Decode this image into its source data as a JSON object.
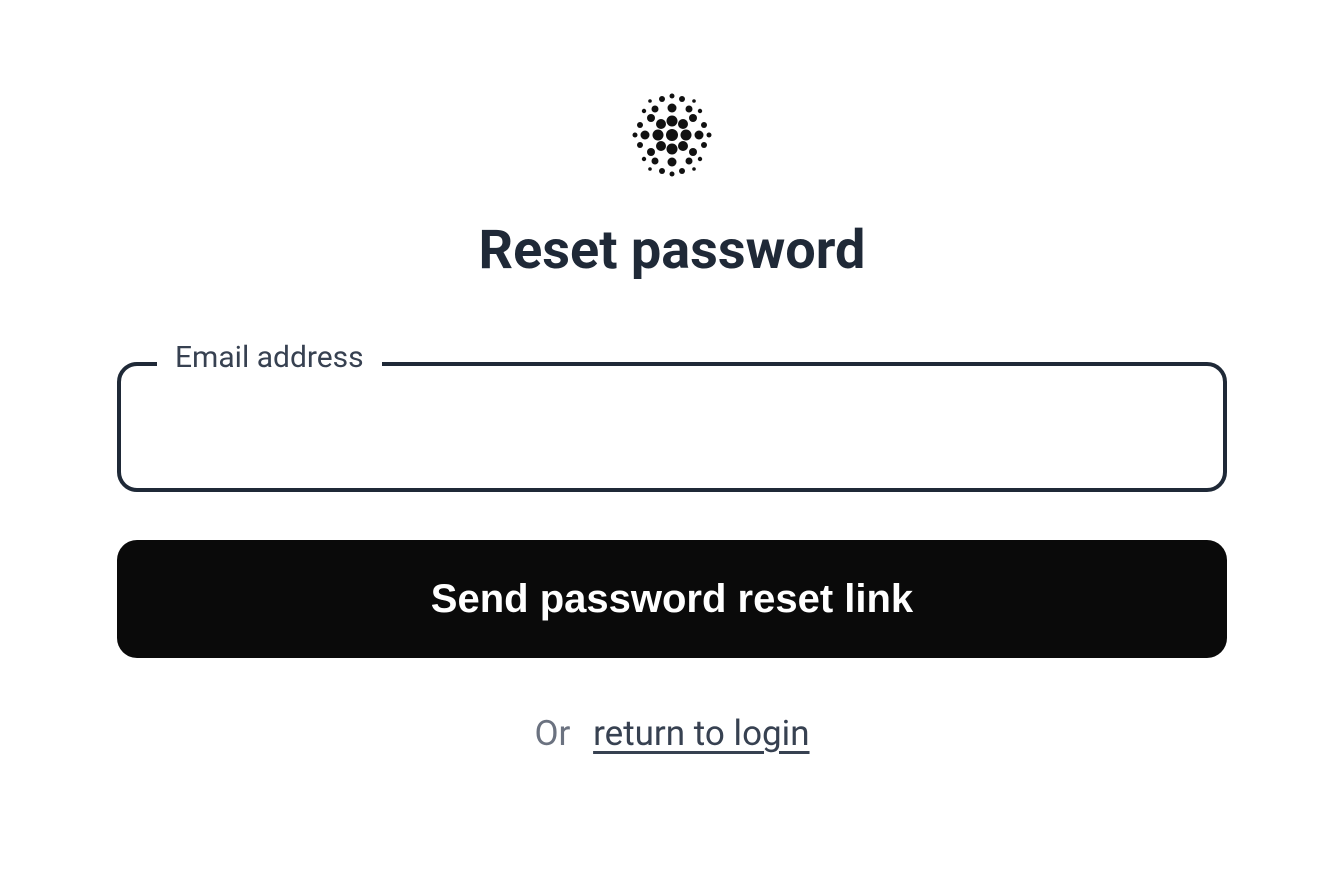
{
  "page": {
    "title": "Reset password"
  },
  "form": {
    "email_label": "Email address",
    "email_value": "",
    "submit_label": "Send password reset link"
  },
  "footer": {
    "prefix_text": "Or",
    "link_text": "return to login"
  }
}
